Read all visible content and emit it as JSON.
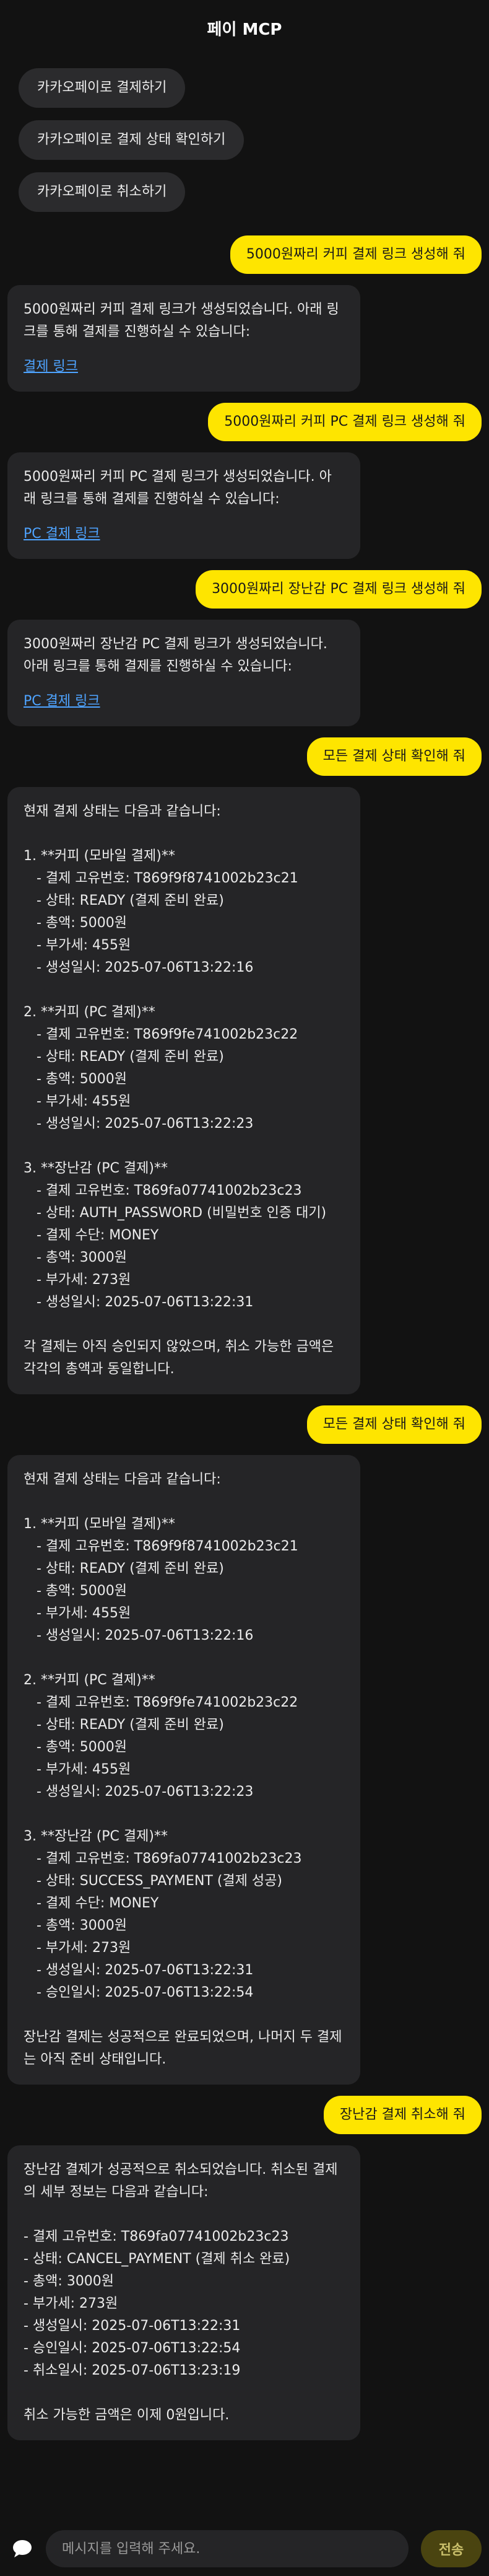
{
  "header": {
    "title": "페이 MCP"
  },
  "suggestions": [
    "카카오페이로 결제하기",
    "카카오페이로 결제 상태 확인하기",
    "카카오페이로 취소하기"
  ],
  "messages": [
    {
      "role": "user",
      "text": "5000원짜리 커피 결제 링크 생성해 줘"
    },
    {
      "role": "bot",
      "text": "5000원짜리 커피 결제 링크가 생성되었습니다. 아래 링크를 통해 결제를 진행하실 수 있습니다:",
      "link": "결제 링크"
    },
    {
      "role": "user",
      "text": "5000원짜리 커피 PC 결제 링크 생성해 줘"
    },
    {
      "role": "bot",
      "text": "5000원짜리 커피 PC 결제 링크가 생성되었습니다. 아래 링크를 통해 결제를 진행하실 수 있습니다:",
      "link": "PC 결제 링크"
    },
    {
      "role": "user",
      "text": "3000원짜리 장난감 PC 결제 링크 생성해 줘"
    },
    {
      "role": "bot",
      "text": "3000원짜리 장난감 PC 결제 링크가 생성되었습니다. 아래 링크를 통해 결제를 진행하실 수 있습니다:",
      "link": "PC 결제 링크"
    },
    {
      "role": "user",
      "text": "모든 결제 상태 확인해 줘"
    },
    {
      "role": "bot",
      "text": "현재 결제 상태는 다음과 같습니다:\n\n1. **커피 (모바일 결제)**\n   - 결제 고유번호: T869f9f8741002b23c21\n   - 상태: READY (결제 준비 완료)\n   - 총액: 5000원\n   - 부가세: 455원\n   - 생성일시: 2025-07-06T13:22:16\n\n2. **커피 (PC 결제)**\n   - 결제 고유번호: T869f9fe741002b23c22\n   - 상태: READY (결제 준비 완료)\n   - 총액: 5000원\n   - 부가세: 455원\n   - 생성일시: 2025-07-06T13:22:23\n\n3. **장난감 (PC 결제)**\n   - 결제 고유번호: T869fa07741002b23c23\n   - 상태: AUTH_PASSWORD (비밀번호 인증 대기)\n   - 결제 수단: MONEY\n   - 총액: 3000원\n   - 부가세: 273원\n   - 생성일시: 2025-07-06T13:22:31\n\n각 결제는 아직 승인되지 않았으며, 취소 가능한 금액은 각각의 총액과 동일합니다."
    },
    {
      "role": "user",
      "text": "모든 결제 상태 확인해 줘"
    },
    {
      "role": "bot",
      "text": "현재 결제 상태는 다음과 같습니다:\n\n1. **커피 (모바일 결제)**\n   - 결제 고유번호: T869f9f8741002b23c21\n   - 상태: READY (결제 준비 완료)\n   - 총액: 5000원\n   - 부가세: 455원\n   - 생성일시: 2025-07-06T13:22:16\n\n2. **커피 (PC 결제)**\n   - 결제 고유번호: T869f9fe741002b23c22\n   - 상태: READY (결제 준비 완료)\n   - 총액: 5000원\n   - 부가세: 455원\n   - 생성일시: 2025-07-06T13:22:23\n\n3. **장난감 (PC 결제)**\n   - 결제 고유번호: T869fa07741002b23c23\n   - 상태: SUCCESS_PAYMENT (결제 성공)\n   - 결제 수단: MONEY\n   - 총액: 3000원\n   - 부가세: 273원\n   - 생성일시: 2025-07-06T13:22:31\n   - 승인일시: 2025-07-06T13:22:54\n\n장난감 결제는 성공적으로 완료되었으며, 나머지 두 결제는 아직 준비 상태입니다."
    },
    {
      "role": "user",
      "text": "장난감 결제 취소해 줘"
    },
    {
      "role": "bot",
      "text": "장난감 결제가 성공적으로 취소되었습니다. 취소된 결제의 세부 정보는 다음과 같습니다:\n\n- 결제 고유번호: T869fa07741002b23c23\n- 상태: CANCEL_PAYMENT (결제 취소 완료)\n- 총액: 3000원\n- 부가세: 273원\n- 생성일시: 2025-07-06T13:22:31\n- 승인일시: 2025-07-06T13:22:54\n- 취소일시: 2025-07-06T13:23:19\n\n취소 가능한 금액은 이제 0원입니다."
    }
  ],
  "composer": {
    "placeholder": "메시지를 입력해 주세요.",
    "send_label": "전송",
    "icon": "chat-bubble-icon"
  },
  "colors": {
    "user_bubble": "#fee500",
    "bot_bubble": "#252527",
    "link": "#4ea3ff",
    "background": "#121212"
  }
}
